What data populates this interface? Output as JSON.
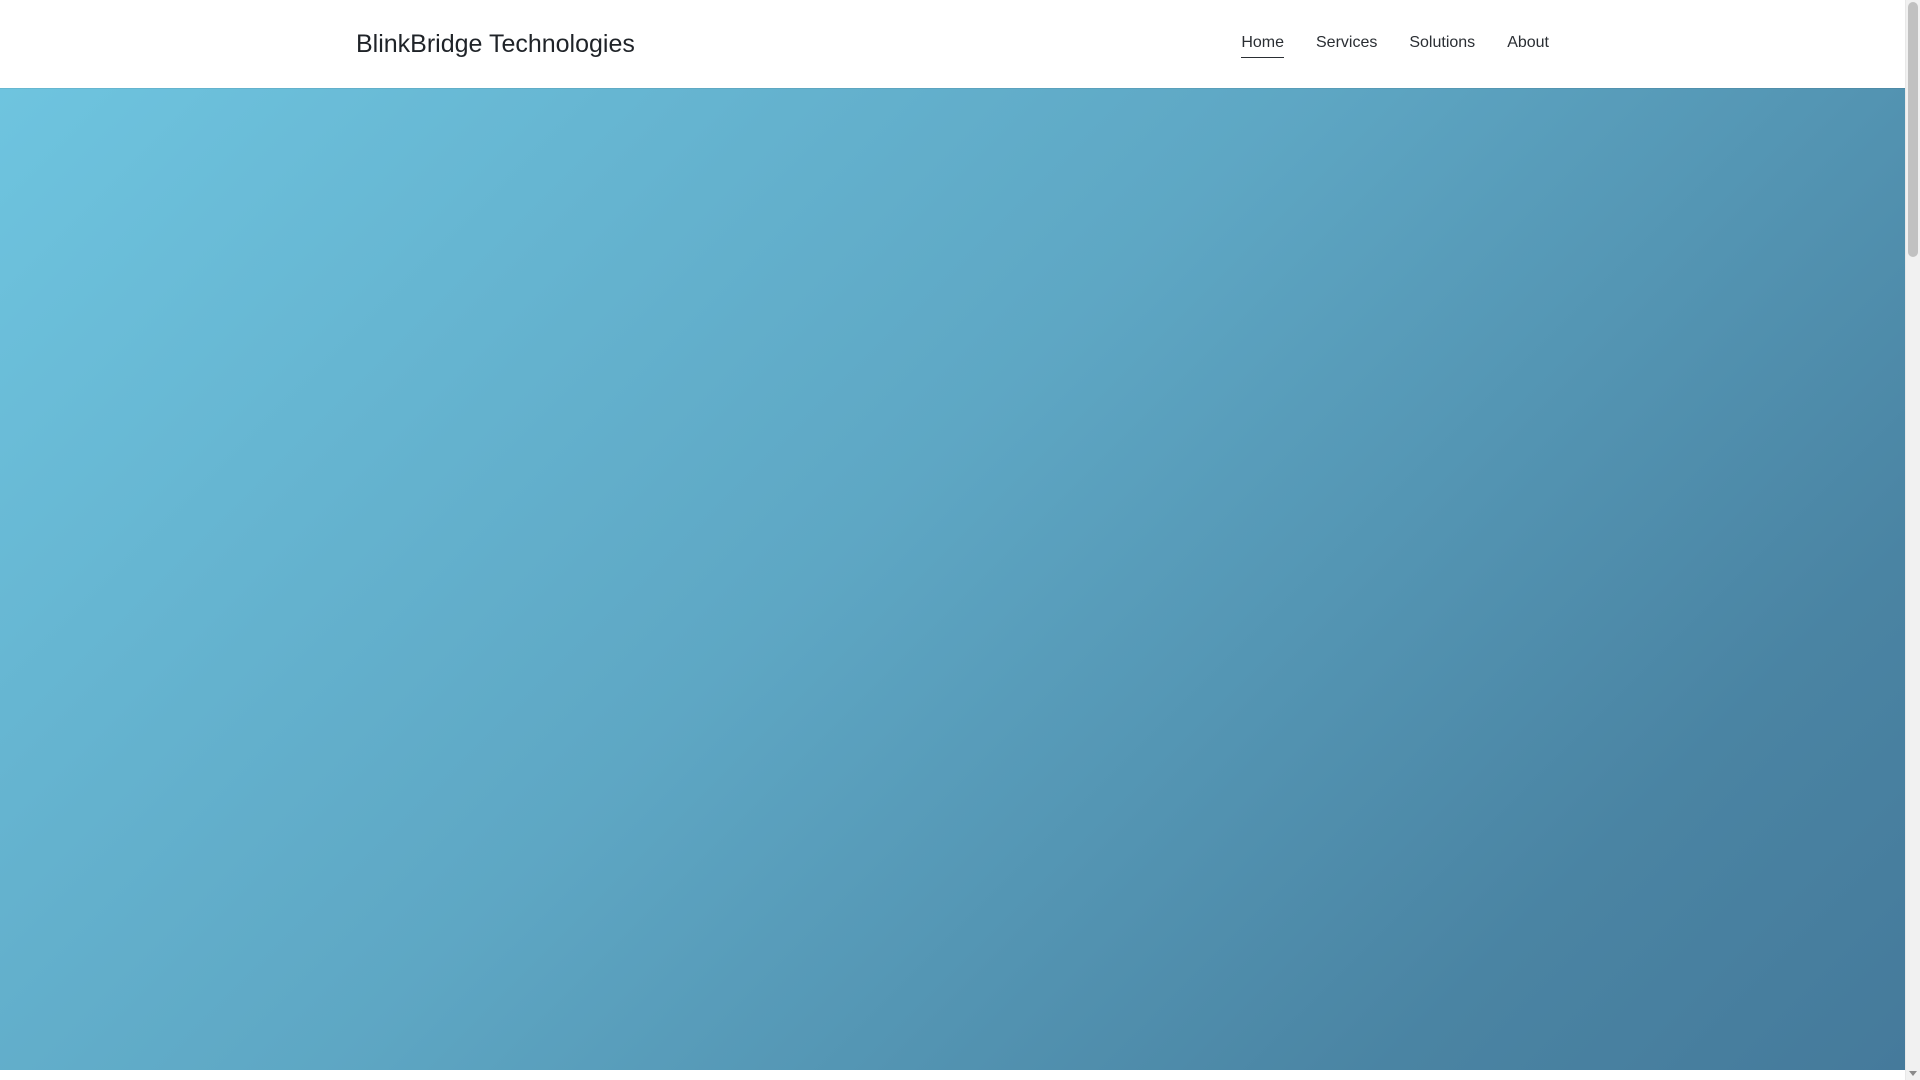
{
  "header": {
    "brand": "BlinkBridge Technologies",
    "nav": [
      {
        "label": "Home",
        "active": true
      },
      {
        "label": "Services",
        "active": false
      },
      {
        "label": "Solutions",
        "active": false
      },
      {
        "label": "About",
        "active": false
      }
    ]
  },
  "hero": {
    "gradient_colors": [
      "#6ec4df",
      "#5ea7c4",
      "#4a84a3",
      "#457a9b"
    ]
  },
  "scrollbar": {
    "thumb_color": "#c1c1c1",
    "track_color": "#f1f1f1",
    "arrow_icon": "chevron-down-icon"
  }
}
